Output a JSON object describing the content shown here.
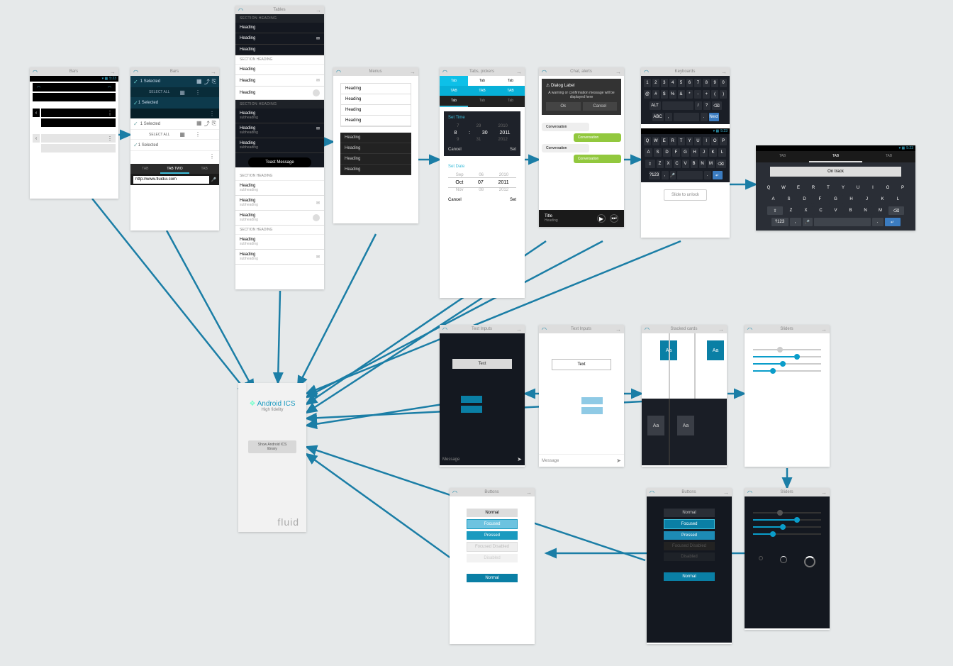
{
  "screens": {
    "bars1": {
      "title": "Bars"
    },
    "bars2": {
      "title": "Bars",
      "selected": "1 Selected",
      "selectall": "SELECT ALL",
      "tabtwo": "TAB TWO",
      "tab": "TAB",
      "url": "http://www.fluidui.com"
    },
    "tables": {
      "title": "Tables",
      "section": "SECTION HEADING",
      "heading": "Heading",
      "subheading": "subheading",
      "toast": "Toast Message"
    },
    "menus": {
      "title": "Menus",
      "heading": "Heading"
    },
    "time": {
      "title": "Tabs, pickers",
      "tab": "Tab",
      "TAB": "TAB",
      "settime": "Set Time",
      "setdate": "Set Date",
      "cancel": "Cancel",
      "set": "Set",
      "h": "8",
      "m": "30",
      "y1": "2011",
      "y0": "2010",
      "y2": "2012",
      "m0": "29",
      "d0": "7",
      "mon1": "Sep",
      "mon2": "Oct",
      "mon3": "Nov",
      "dd1": "06",
      "dd2": "07",
      "dd3": "08"
    },
    "chat": {
      "title": "Chat, alerts",
      "dialog": "Dialog Label",
      "warn": "A warning or confirmation message will be displayed here",
      "ok": "Ok",
      "cancel": "Cancel",
      "conv": "Conversation",
      "titleh": "Title",
      "sub": "Heading"
    },
    "kb": {
      "title": "Keyboards",
      "tb": "Slide to unlock",
      "row1": "1234567890",
      "row2": "@#$%&*-+()",
      "row3": "QWERTYUIOP",
      "row4": "ASDFGHJKL",
      "row5": "ZXCVBNM"
    },
    "kb2": {
      "tab": "TAB",
      "ontrack": "On track"
    },
    "home": {
      "title": "Android ICS",
      "sub": "High fidelity",
      "btn": "Show Android ICS library",
      "brand": "fluid"
    },
    "text1": {
      "title": "Text Inputs",
      "text": "Text",
      "msg": "Message"
    },
    "text2": {
      "title": "Text Inputs",
      "text": "Text",
      "msg": "Message"
    },
    "stack": {
      "title": "Stacked cards",
      "aa": "Aa"
    },
    "sliders": {
      "title": "Sliders"
    },
    "buttons1": {
      "title": "Buttons",
      "normal": "Normal",
      "focused": "Focused",
      "pressed": "Pressed",
      "disabled": "Focused Disabled",
      "dis": "Disabled"
    },
    "buttons2": {
      "title": "Buttons"
    },
    "sliders2": {
      "title": "Sliders"
    }
  },
  "status": {
    "time": "5:23"
  }
}
